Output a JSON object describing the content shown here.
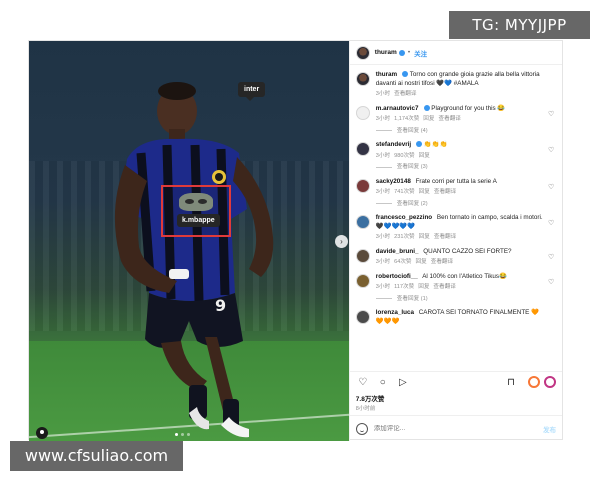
{
  "watermarks": {
    "tg": "TG: MYYJJPP",
    "site": "www.cfsuliao.com"
  },
  "media": {
    "tag_inter": "inter",
    "tag_mbappe": "k.mbappe",
    "jersey_number": "9"
  },
  "header": {
    "username": "thuram",
    "separator": "•",
    "follow_label": "关注"
  },
  "caption": {
    "username": "thuram",
    "text": "Torno con grande gioia grazie alla bella vittoria davanti ai nostri tifosi 🖤💙 #AMALA",
    "time": "3小时",
    "translate": "查看翻译"
  },
  "comments": [
    {
      "username": "m.arnautovic7",
      "text": "Playground for you this 😂",
      "time": "3小时",
      "likes": "1,174次赞",
      "reply": "回复",
      "translate": "查看翻译",
      "replies": "查看回复 (4)"
    },
    {
      "username": "stefandevrij",
      "text": "👏👏👏",
      "time": "3小时",
      "likes": "980次赞",
      "reply": "回复",
      "translate": "",
      "replies": "查看回复 (3)"
    },
    {
      "username": "sacky20148",
      "text": "Frate corri per tutta la serie A",
      "time": "3小时",
      "likes": "741次赞",
      "reply": "回复",
      "translate": "查看翻译",
      "replies": "查看回复 (2)"
    },
    {
      "username": "francesco_pezzino",
      "text": "Ben tornato in campo, scalda i motori. 🖤💙💙💙💙",
      "time": "3小时",
      "likes": "231次赞",
      "reply": "回复",
      "translate": "查看翻译",
      "replies": ""
    },
    {
      "username": "davide_bruni_",
      "text": "QUANTO CAZZO SEI FORTE?",
      "time": "3小时",
      "likes": "64次赞",
      "reply": "回复",
      "translate": "查看翻译",
      "replies": ""
    },
    {
      "username": "robertociofi__",
      "text": "Al 100% con l'Atletico Tikus😂",
      "time": "3小时",
      "likes": "117次赞",
      "reply": "回复",
      "translate": "查看翻译",
      "replies": "查看回复 (1)"
    },
    {
      "username": "lorenza_luca",
      "text": "CAROTA SEI TORNATO FINALMENTE 🧡🧡🧡🧡",
      "time": "",
      "likes": "",
      "reply": "",
      "translate": "",
      "replies": ""
    }
  ],
  "actions": {
    "like_icon": "♡",
    "comment_icon": "○",
    "share_icon": "▷",
    "save_icon": "⊓"
  },
  "likes": "7.8万次赞",
  "post_time": "8小时前",
  "add_comment": {
    "placeholder": "添加评论...",
    "post_label": "发布"
  }
}
